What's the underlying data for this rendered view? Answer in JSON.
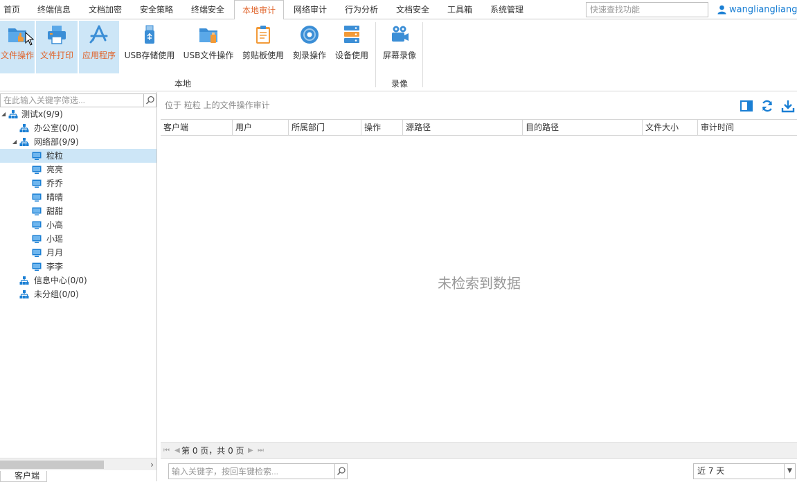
{
  "menu": {
    "items": [
      "首页",
      "终端信息",
      "文档加密",
      "安全策略",
      "终端安全",
      "本地审计",
      "网络审计",
      "行为分析",
      "文档安全",
      "工具箱",
      "系统管理"
    ],
    "active_index": 5,
    "quick_search_placeholder": "快速查找功能",
    "username": "wangliangliang"
  },
  "ribbon": {
    "groups": [
      {
        "label": "本地",
        "buttons": [
          "文件操作",
          "文件打印",
          "应用程序",
          "USB存储使用",
          "USB文件操作",
          "剪贴板使用",
          "刻录操作",
          "设备使用"
        ]
      },
      {
        "label": "录像",
        "buttons": [
          "屏幕录像"
        ]
      }
    ],
    "selected_buttons": [
      "文件操作",
      "文件打印",
      "应用程序"
    ],
    "accent_color": "#e0642b",
    "icon_color": "#1a8ad4"
  },
  "tree": {
    "search_placeholder": "在此输入关键字筛选...",
    "nodes": [
      {
        "label": "测试x(9/9)",
        "type": "group",
        "level": 0,
        "expanded": true
      },
      {
        "label": "办公室(0/0)",
        "type": "group",
        "level": 1
      },
      {
        "label": "网络部(9/9)",
        "type": "group",
        "level": 1,
        "expanded": true
      },
      {
        "label": "粒粒",
        "type": "computer",
        "level": 2,
        "selected": true
      },
      {
        "label": "亮亮",
        "type": "computer",
        "level": 2
      },
      {
        "label": "乔乔",
        "type": "computer",
        "level": 2
      },
      {
        "label": "晴晴",
        "type": "computer",
        "level": 2
      },
      {
        "label": "甜甜",
        "type": "computer",
        "level": 2
      },
      {
        "label": "小高",
        "type": "computer",
        "level": 2
      },
      {
        "label": "小瑶",
        "type": "computer",
        "level": 2
      },
      {
        "label": "月月",
        "type": "computer",
        "level": 2
      },
      {
        "label": "李李",
        "type": "computer",
        "level": 2
      },
      {
        "label": "信息中心(0/0)",
        "type": "group",
        "level": 1
      },
      {
        "label": "未分组(0/0)",
        "type": "group",
        "level": 1
      }
    ],
    "bottom_tab": "客户端"
  },
  "main": {
    "location_text": "位于 粒粒 上的文件操作审计",
    "columns": [
      "客户端",
      "用户",
      "所属部门",
      "操作",
      "源路径",
      "目的路径",
      "文件大小",
      "审计时间"
    ],
    "empty_message": "未检索到数据",
    "pager_text": "第 0 页，共 0 页",
    "search_placeholder": "输入关键字，按回车键检索...",
    "time_range": "近 7 天"
  }
}
